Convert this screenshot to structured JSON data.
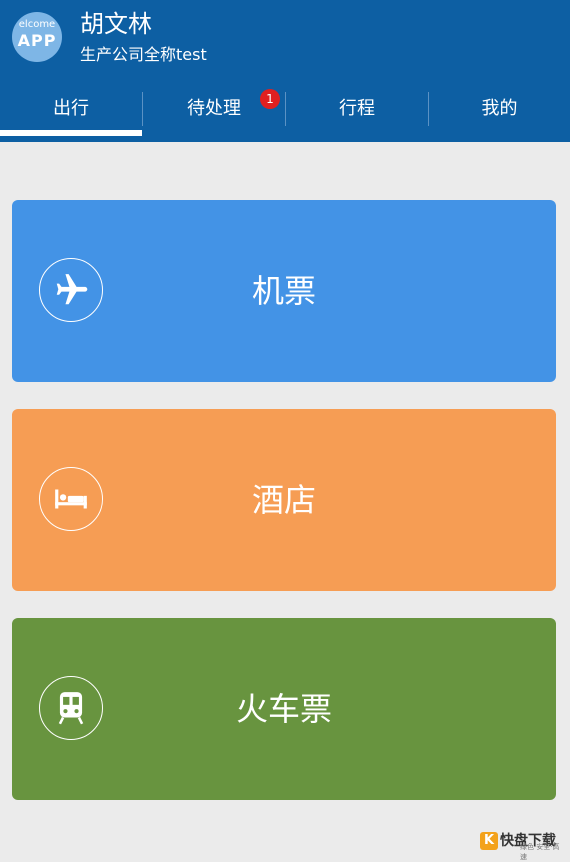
{
  "header": {
    "avatar_text_top": "elcome",
    "avatar_text_main": "APP",
    "user_name": "胡文林",
    "company": "生产公司全称test"
  },
  "tabs": [
    {
      "label": "出行",
      "active": true
    },
    {
      "label": "待处理",
      "badge": "1"
    },
    {
      "label": "行程"
    },
    {
      "label": "我的"
    }
  ],
  "cards": [
    {
      "label": "机票",
      "icon": "airplane-icon",
      "color": "#4393e6"
    },
    {
      "label": "酒店",
      "icon": "bed-icon",
      "color": "#f69d54"
    },
    {
      "label": "火车票",
      "icon": "train-icon",
      "color": "#68943f"
    }
  ],
  "watermark": {
    "mark": "K",
    "brand": "快盘下载",
    "tagline": "绿色·安全·高速"
  }
}
